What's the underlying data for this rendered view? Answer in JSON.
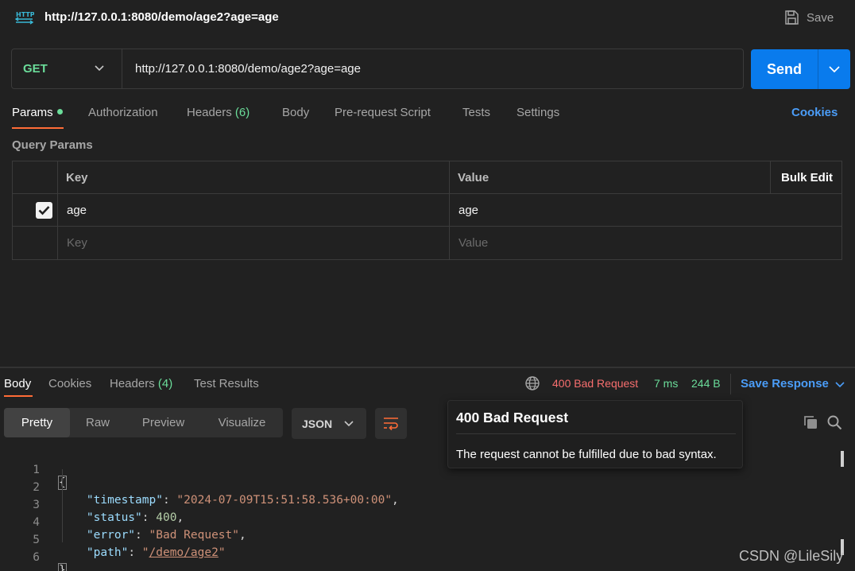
{
  "title_bar": {
    "protocol_icon": "http-icon",
    "request_name": "http://127.0.0.1:8080/demo/age2?age=age",
    "save_label": "Save",
    "save_icon": "floppy-disk-icon"
  },
  "request": {
    "method": "GET",
    "url": "http://127.0.0.1:8080/demo/age2?age=age",
    "send_label": "Send"
  },
  "request_tabs": {
    "params": "Params",
    "authorization": "Authorization",
    "headers": "Headers",
    "headers_count": "(6)",
    "body": "Body",
    "prerequest": "Pre-request Script",
    "tests": "Tests",
    "settings": "Settings",
    "cookies": "Cookies"
  },
  "query_params": {
    "section_label": "Query Params",
    "columns": {
      "key": "Key",
      "value": "Value",
      "bulk_edit": "Bulk Edit"
    },
    "rows": [
      {
        "checked": true,
        "key": "age",
        "value": "age"
      }
    ],
    "new_row": {
      "key_placeholder": "Key",
      "value_placeholder": "Value"
    }
  },
  "response_tabs": {
    "body": "Body",
    "cookies": "Cookies",
    "headers": "Headers",
    "headers_count": "(4)",
    "test_results": "Test Results"
  },
  "response_meta": {
    "status": "400 Bad Request",
    "time": "7 ms",
    "size": "244 B",
    "save_response": "Save Response"
  },
  "view_modes": {
    "pretty": "Pretty",
    "raw": "Raw",
    "preview": "Preview",
    "visualize": "Visualize",
    "format": "JSON"
  },
  "response_body": {
    "line_numbers": [
      "1",
      "2",
      "3",
      "4",
      "5",
      "6"
    ],
    "timestamp_key": "\"timestamp\"",
    "timestamp_value": "\"2024-07-09T15:51:58.536+00:00\"",
    "status_key": "\"status\"",
    "status_value": "400",
    "error_key": "\"error\"",
    "error_value": "\"Bad Request\"",
    "path_key": "\"path\"",
    "path_value": "/demo/age2"
  },
  "tooltip": {
    "title": "400 Bad Request",
    "description": "The request cannot be fulfilled due to bad syntax."
  },
  "watermark": "CSDN @LileSily",
  "colors": {
    "background": "#212121",
    "accent_orange": "#ff6c37",
    "send_blue": "#097bed",
    "link_blue": "#4b9df8",
    "method_green": "#6bdd9a",
    "error_red": "#f76e6e"
  }
}
